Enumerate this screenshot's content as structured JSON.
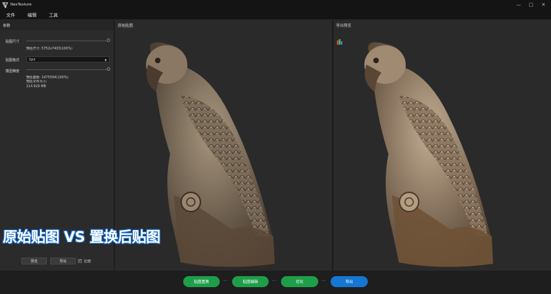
{
  "app": {
    "title": "NexTexture"
  },
  "menu": [
    {
      "label": "文件"
    },
    {
      "label": "编辑"
    },
    {
      "label": "工具"
    }
  ],
  "window_controls": {
    "minimize": "—",
    "maximize": "□",
    "close": "✕"
  },
  "params_panel": {
    "header": "参数",
    "texture_size_label": "贴图尺寸",
    "texture_size_info": "预估尺寸: 5752x7403(100%)",
    "texture_format_label": "贴图格式",
    "texture_format_value": "1px",
    "model_precision_label": "模型精度",
    "model_faces_info": "预估面数: 1475094(100%)",
    "file_size_label": "预估文件大小:",
    "file_size_value": "114.929 MB",
    "preview_button": "预览",
    "export_button": "导出",
    "compare_checkbox": "比较",
    "compare_checked": true,
    "texture_size_level": 1.0,
    "model_precision_level": 1.0
  },
  "original_view": {
    "header": "原始贴图"
  },
  "export_view": {
    "header": "导出预览"
  },
  "overlay_caption": "原始贴图 VS 置换后贴图",
  "workflow": {
    "steps": [
      {
        "label": "贴图置换",
        "color": "#1f9e4a"
      },
      {
        "label": "贴图编辑",
        "color": "#1f9e4a"
      },
      {
        "label": "优化",
        "color": "#1f9e4a"
      },
      {
        "label": "导出",
        "color": "#1677d2"
      }
    ],
    "connector": "···"
  }
}
